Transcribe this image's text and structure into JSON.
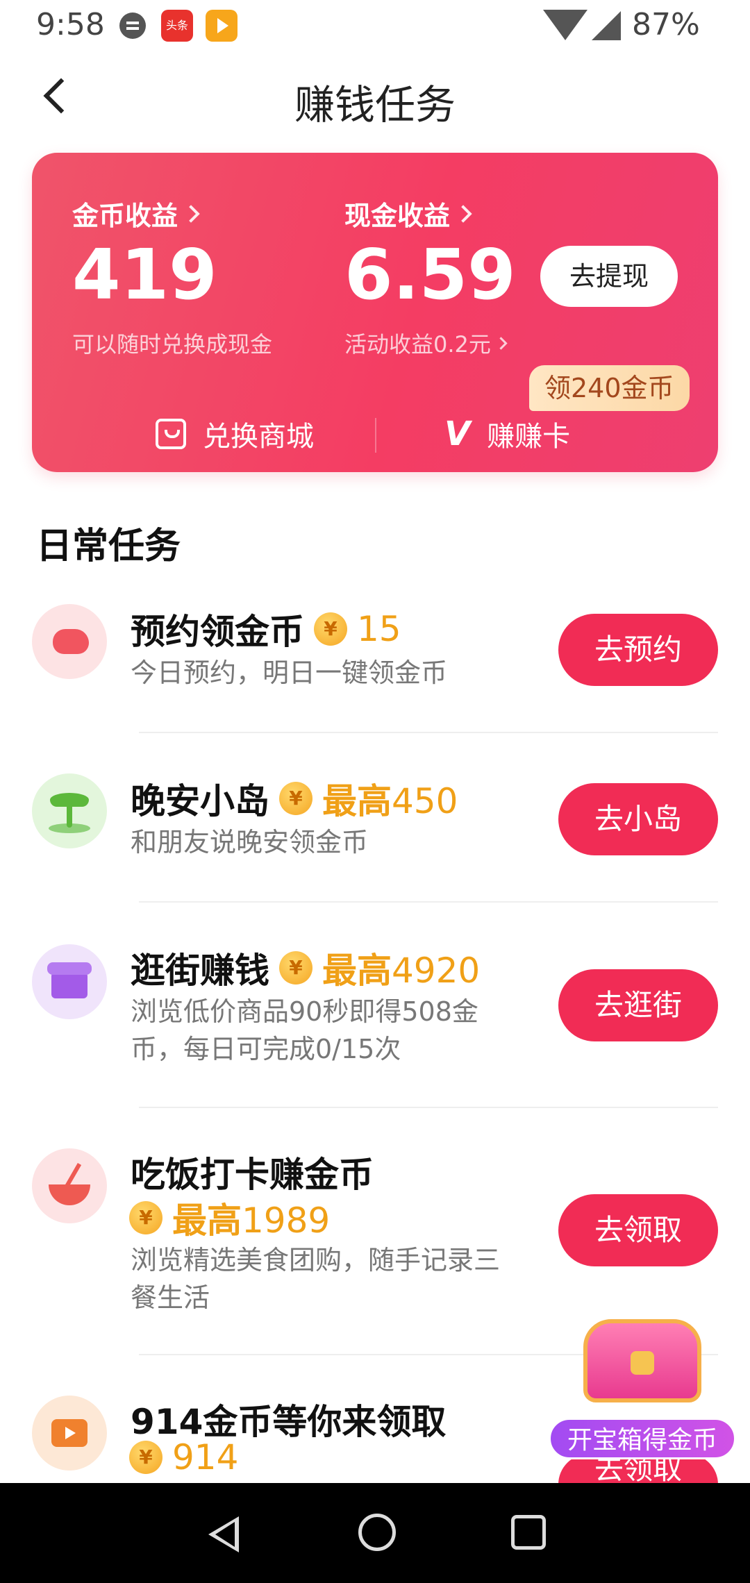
{
  "status_bar": {
    "time": "9:58",
    "battery": "87%",
    "app_badge": "头条"
  },
  "header": {
    "title": "赚钱任务"
  },
  "earnings": {
    "coin_label": "金币收益",
    "coin_value": "419",
    "coin_sub": "可以随时兑换成现金",
    "cash_label": "现金收益",
    "cash_value": "6.59",
    "cash_sub": "活动收益0.2元",
    "withdraw_label": "去提现",
    "shop_label": "兑换商城",
    "card_label": "赚赚卡",
    "badge": "领240金币"
  },
  "section": {
    "title": "日常任务"
  },
  "tasks": [
    {
      "name": "预约领金币",
      "prefix": "",
      "amount": "15",
      "desc": "今日预约，明日一键领金币",
      "button": "去预约",
      "icon": "piggy-bank-icon"
    },
    {
      "name": "晚安小岛",
      "prefix": "最高",
      "amount": "450",
      "desc": "和朋友说晚安领金币",
      "button": "去小岛",
      "icon": "island-icon"
    },
    {
      "name": "逛街赚钱",
      "prefix": "最高",
      "amount": "4920",
      "desc": "浏览低价商品90秒即得508金币，每日可完成0/15次",
      "button": "去逛街",
      "icon": "shop-icon"
    },
    {
      "name": "吃饭打卡赚金币",
      "prefix": "最高",
      "amount": "1989",
      "desc": "浏览精选美食团购，随手记录三餐生活",
      "button": "去领取",
      "icon": "bowl-icon"
    },
    {
      "name": "914金币等你来领取",
      "prefix": "",
      "amount": "914",
      "desc": "",
      "button": "去领取",
      "icon": "tv-icon"
    }
  ],
  "coin_symbol": "¥",
  "treasure": {
    "label": "开宝箱得金币"
  },
  "colors": {
    "accent": "#f12c55",
    "reward": "#f0a017"
  }
}
